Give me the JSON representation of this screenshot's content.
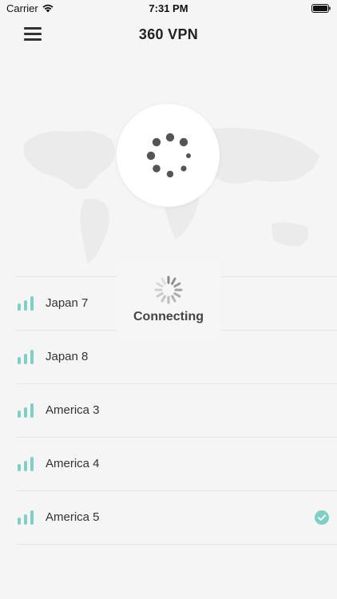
{
  "status_bar": {
    "carrier": "Carrier",
    "time": "7:31 PM"
  },
  "nav": {
    "title": "360 VPN",
    "menu_icon": "hamburger-menu-icon"
  },
  "connect_button": {
    "icon": "loading-dots-icon"
  },
  "servers": [
    {
      "name": "Japan 7",
      "selected": false
    },
    {
      "name": "Japan 8",
      "selected": false
    },
    {
      "name": "America 3",
      "selected": false
    },
    {
      "name": "America 4",
      "selected": false
    },
    {
      "name": "America 5",
      "selected": true
    }
  ],
  "hud": {
    "text": "Connecting"
  },
  "colors": {
    "accent": "#7fcfc6",
    "background": "#f5f5f5",
    "text": "#333333"
  }
}
